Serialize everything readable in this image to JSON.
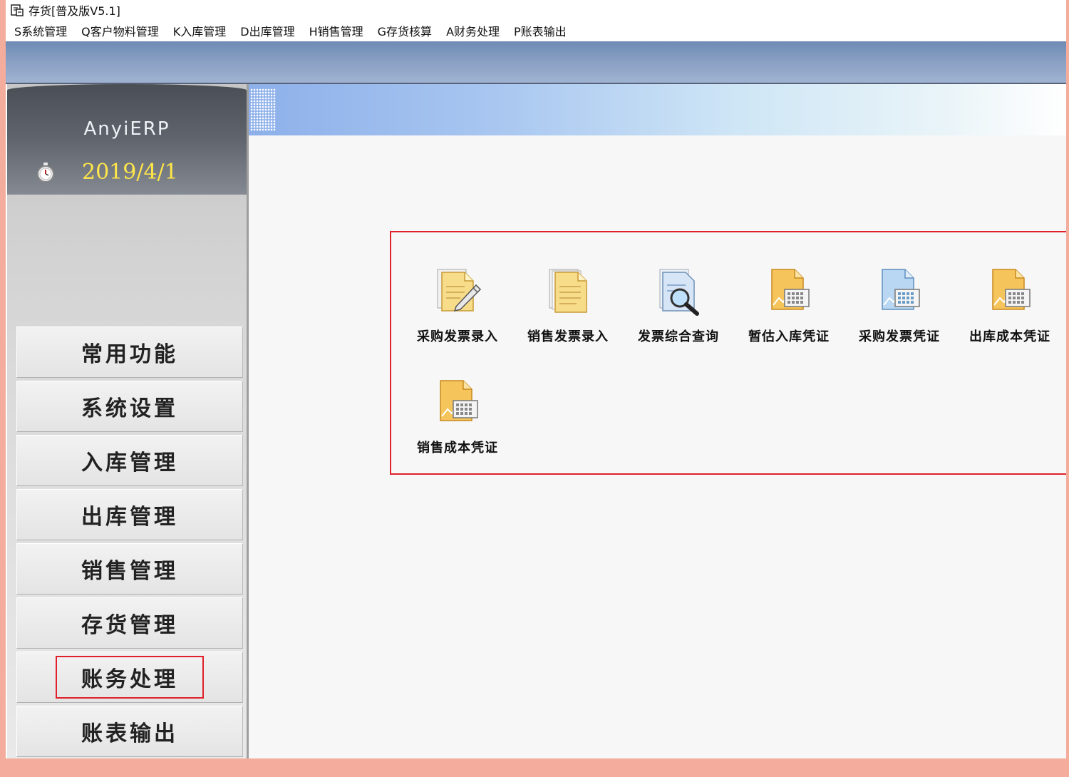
{
  "window": {
    "title": "存货[普及版V5.1]"
  },
  "menu": [
    "S系统管理",
    "Q客户物料管理",
    "K入库管理",
    "D出库管理",
    "H销售管理",
    "G存货核算",
    "A财务处理",
    "P账表输出"
  ],
  "brand": {
    "name": "AnyiERP",
    "date": "2019/4/1"
  },
  "nav": [
    {
      "label": "常用功能"
    },
    {
      "label": "系统设置"
    },
    {
      "label": "入库管理"
    },
    {
      "label": "出库管理"
    },
    {
      "label": "销售管理"
    },
    {
      "label": "存货管理"
    },
    {
      "label": "账务处理",
      "selected": true
    },
    {
      "label": "账表输出"
    }
  ],
  "functions": [
    {
      "label": "采购发票录入",
      "icon": "document-edit-icon"
    },
    {
      "label": "销售发票录入",
      "icon": "documents-icon"
    },
    {
      "label": "发票综合查询",
      "icon": "document-search-icon"
    },
    {
      "label": "暂估入库凭证",
      "icon": "voucher-icon"
    },
    {
      "label": "采购发票凭证",
      "icon": "voucher-blue-icon"
    },
    {
      "label": "出库成本凭证",
      "icon": "voucher-icon"
    },
    {
      "label": "销售成本凭证",
      "icon": "voucher-icon"
    }
  ],
  "colors": {
    "highlight_border": "#e0202a",
    "date_text": "#ffe64a",
    "outer_background": "#f4ad9c"
  }
}
